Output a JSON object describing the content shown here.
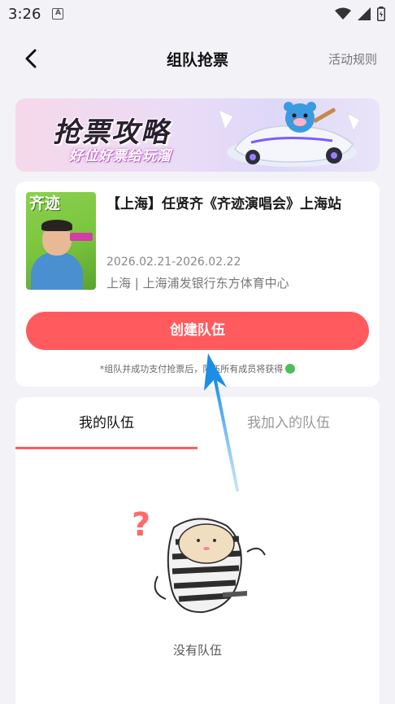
{
  "status_bar": {
    "time": "3:26",
    "notification_icon": "a-icon"
  },
  "nav": {
    "title": "组队抢票",
    "rules_label": "活动规则"
  },
  "banner": {
    "title": "抢票攻略",
    "subtitle": "好位好票给玩溜"
  },
  "event": {
    "title": "【上海】任贤齐《齐迹演唱会》上海站",
    "date": "2026.02.21-2026.02.22",
    "venue": "上海 | 上海浦发银行东方体育中心",
    "poster_text": "齐迹",
    "create_button_label": "创建队伍",
    "hint": "*组队并成功支付抢票后，队伍所有成员将获得"
  },
  "teams": {
    "tabs": [
      {
        "label": "我的队伍",
        "active": true
      },
      {
        "label": "我加入的队伍",
        "active": false
      }
    ],
    "empty_text": "没有队伍"
  },
  "colors": {
    "accent": "#ff5b5f",
    "background": "#f2f2f7"
  }
}
